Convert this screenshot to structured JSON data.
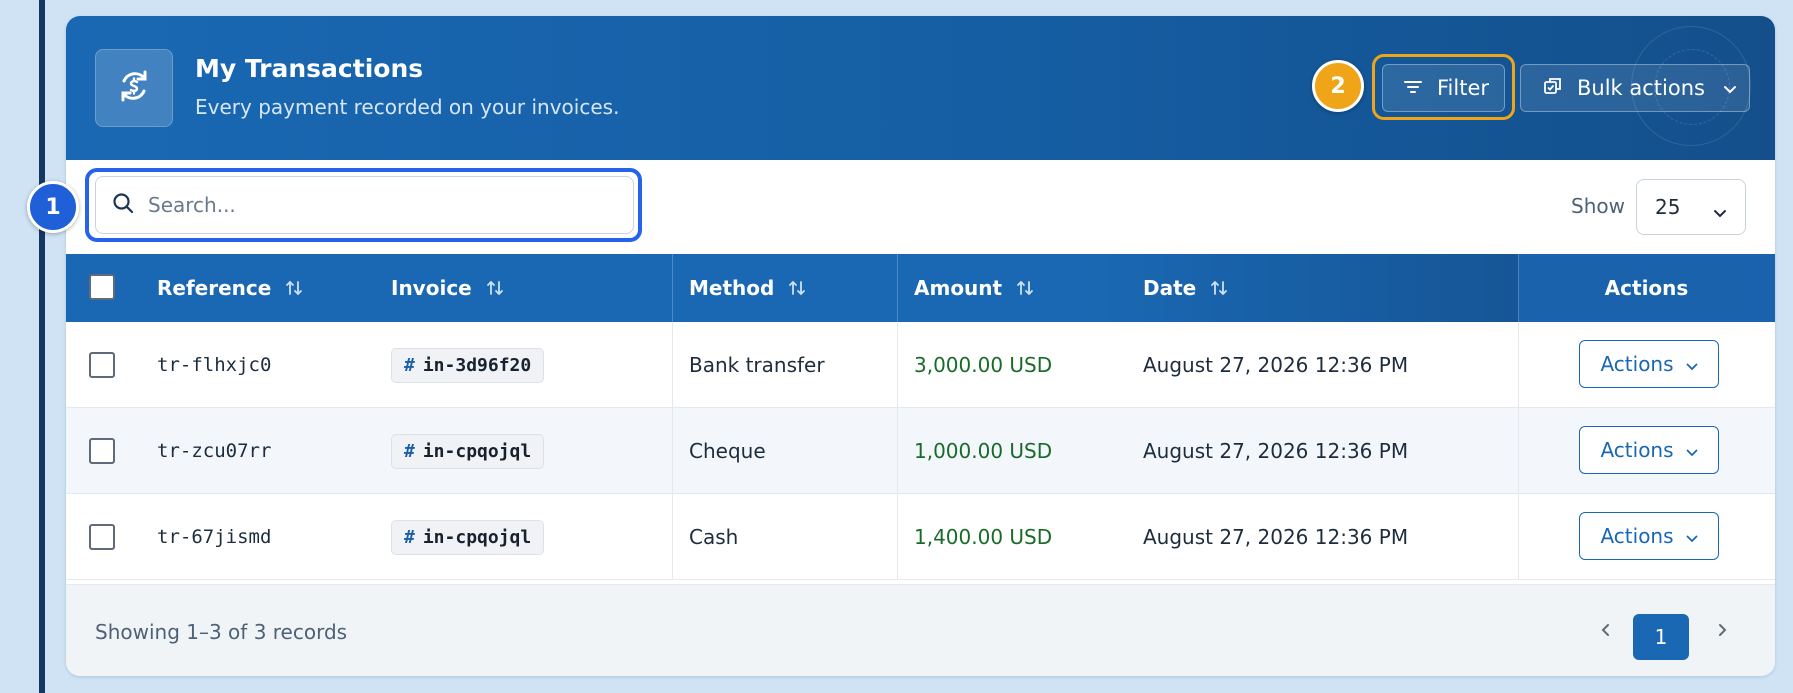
{
  "header": {
    "title": "My Transactions",
    "subtitle": "Every payment recorded on your invoices.",
    "icon": "currency-exchange-icon",
    "filter_label": "Filter",
    "bulk_actions_label": "Bulk actions"
  },
  "callouts": {
    "one": "1",
    "two": "2"
  },
  "toolbar": {
    "search_placeholder": "Search...",
    "search_value": "",
    "show_label": "Show",
    "show_value": "25"
  },
  "table": {
    "columns": {
      "reference": "Reference",
      "invoice": "Invoice",
      "method": "Method",
      "amount": "Amount",
      "date": "Date",
      "actions": "Actions"
    },
    "rows": [
      {
        "reference": "tr-flhxjc0",
        "invoice": "in-3d96f20",
        "method": "Bank transfer",
        "amount": "3,000.00 USD",
        "date": "August 27, 2026 12:36 PM",
        "actions": "Actions"
      },
      {
        "reference": "tr-zcu07rr",
        "invoice": "in-cpqojql",
        "method": "Cheque",
        "amount": "1,000.00 USD",
        "date": "August 27, 2026 12:36 PM",
        "actions": "Actions"
      },
      {
        "reference": "tr-67jismd",
        "invoice": "in-cpqojql",
        "method": "Cash",
        "amount": "1,400.00 USD",
        "date": "August 27, 2026 12:36 PM",
        "actions": "Actions"
      }
    ]
  },
  "footer": {
    "summary": "Showing 1–3 of 3 records",
    "current_page": "1"
  },
  "colors": {
    "primary": "#1a68b3",
    "callout_orange": "#f0a417",
    "callout_blue": "#1f5fd7",
    "amount_green": "#1a6b2a"
  }
}
